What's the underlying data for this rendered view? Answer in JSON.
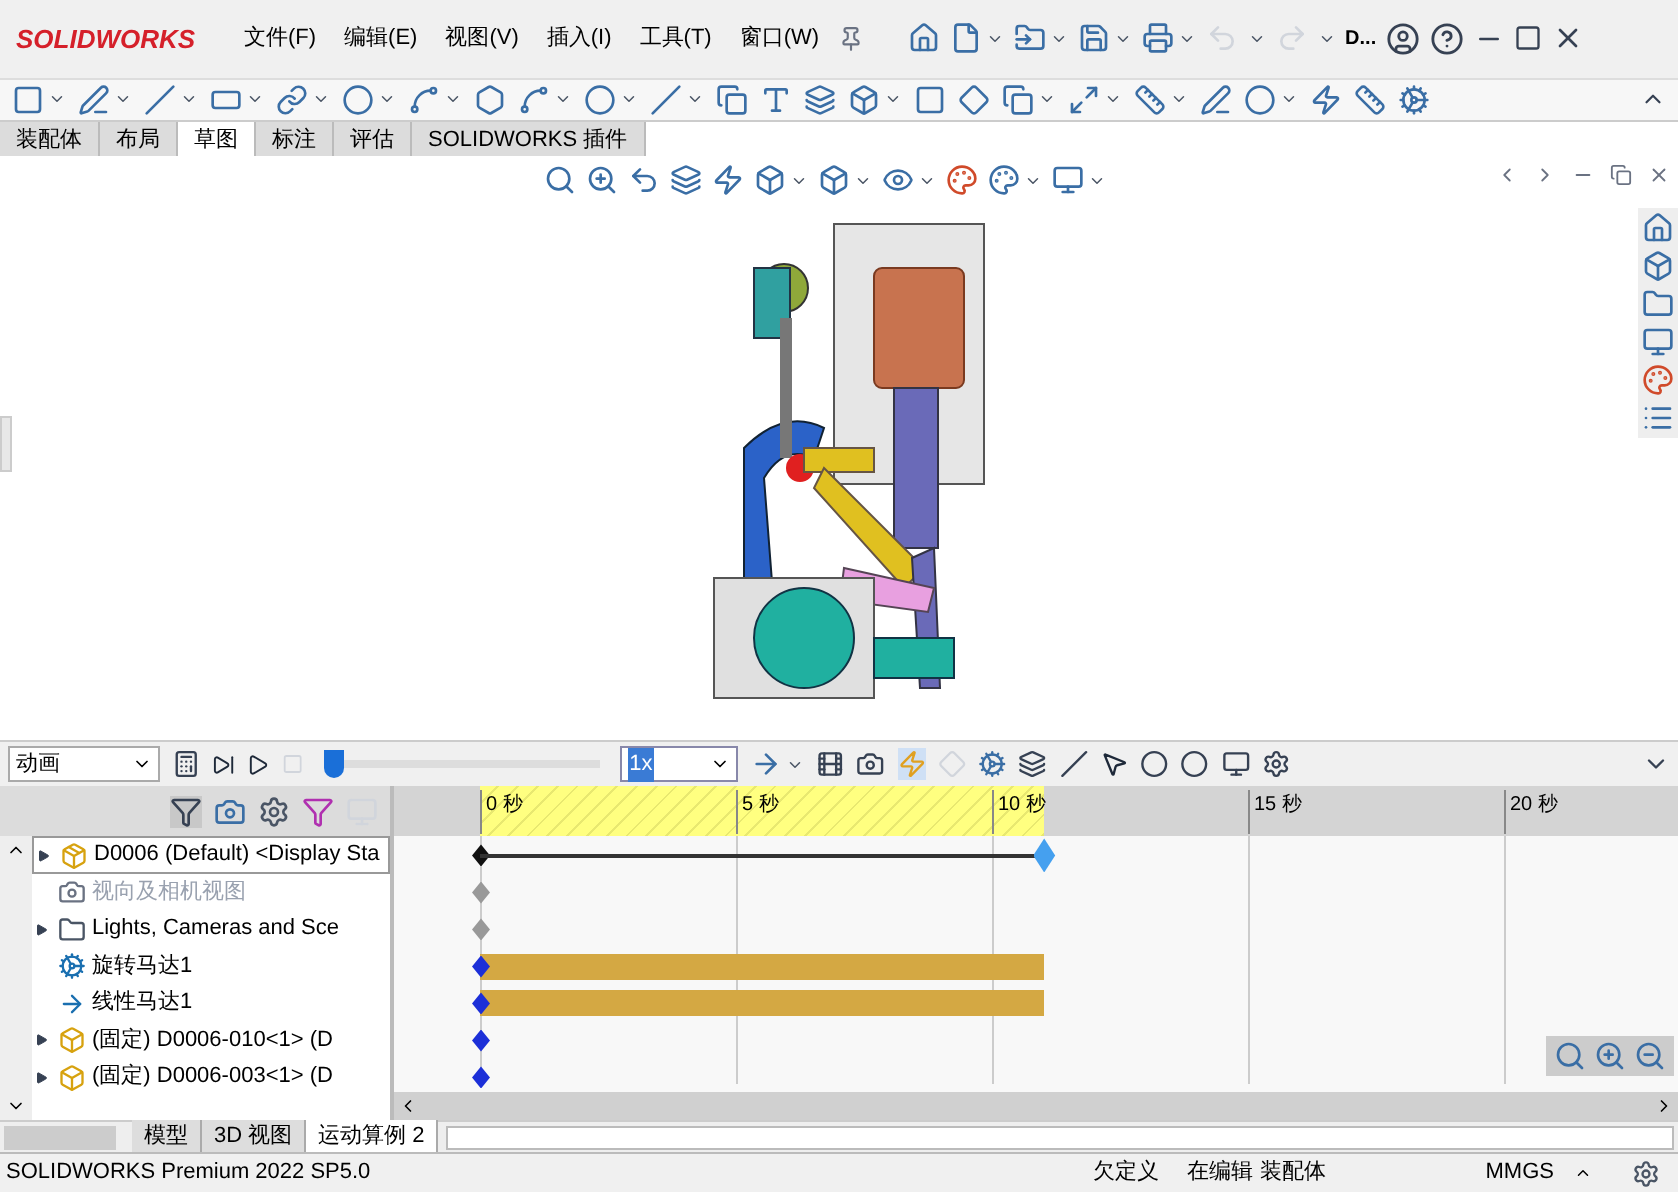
{
  "app": {
    "logo": "SOLIDWORKS",
    "menus": [
      "文件(F)",
      "编辑(E)",
      "视图(V)",
      "插入(I)",
      "工具(T)",
      "窗口(W)"
    ],
    "search_hint": "D..."
  },
  "tabs": [
    {
      "label": "装配体",
      "selected": false
    },
    {
      "label": "布局",
      "selected": false
    },
    {
      "label": "草图",
      "selected": true
    },
    {
      "label": "标注",
      "selected": false
    },
    {
      "label": "评估",
      "selected": false
    },
    {
      "label": "SOLIDWORKS 插件",
      "selected": false
    }
  ],
  "motion": {
    "study_type": "动画",
    "speed": "1x",
    "playhead": {
      "level": 0
    },
    "ruler": [
      "0 秒",
      "5 秒",
      "10 秒",
      "15 秒",
      "20 秒"
    ],
    "tree": [
      {
        "label": "D0006 (Default) <Display Sta",
        "kind": "assembly",
        "expandable": true,
        "greyed": false,
        "selected": true
      },
      {
        "label": "视向及相机视图",
        "kind": "view",
        "expandable": false,
        "greyed": true,
        "selected": false
      },
      {
        "label": "Lights, Cameras and Sce",
        "kind": "folder",
        "expandable": true,
        "greyed": false,
        "selected": false
      },
      {
        "label": "旋转马达1",
        "kind": "rotary",
        "expandable": false,
        "greyed": false,
        "selected": false
      },
      {
        "label": "线性马达1",
        "kind": "linear",
        "expandable": false,
        "greyed": false,
        "selected": false
      },
      {
        "label": "(固定) D0006-010<1> (D",
        "kind": "component",
        "expandable": true,
        "greyed": false,
        "selected": false
      },
      {
        "label": "(固定) D0006-003<1> (D",
        "kind": "component",
        "expandable": true,
        "greyed": false,
        "selected": false
      }
    ]
  },
  "bottom_tabs": [
    {
      "label": "模型",
      "selected": false
    },
    {
      "label": "3D 视图",
      "selected": false
    },
    {
      "label": "运动算例 2",
      "selected": true
    }
  ],
  "status_bar": {
    "product": "SOLIDWORKS Premium 2022 SP5.0",
    "state": "欠定义",
    "mode": "在编辑 装配体",
    "units": "MMGS"
  }
}
